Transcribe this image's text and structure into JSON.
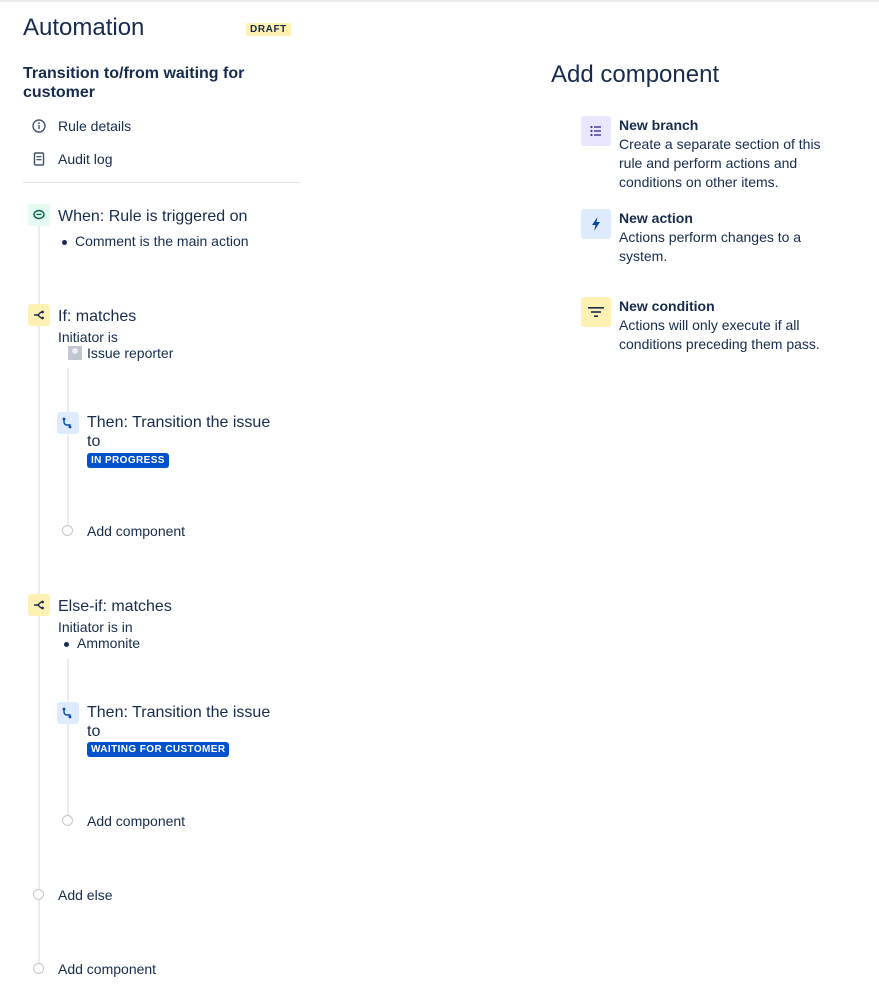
{
  "header": {
    "title": "Automation",
    "draft_badge": "DRAFT"
  },
  "rule": {
    "name": "Transition to/from waiting for customer"
  },
  "nav": {
    "rule_details": "Rule details",
    "audit_log": "Audit log"
  },
  "trigger": {
    "title": "When: Rule is triggered on",
    "bullet": "Comment is the main action"
  },
  "if_block": {
    "title": "If: matches",
    "sub": "Initiator is",
    "user": "Issue reporter",
    "action": {
      "title": "Then: Transition the issue to",
      "status": "IN PROGRESS"
    },
    "add_component": "Add component"
  },
  "elseif_block": {
    "title": "Else-if: matches",
    "sub": "Initiator is in",
    "bullet": "Ammonite",
    "action": {
      "title": "Then: Transition the issue to",
      "status": "WAITING FOR CUSTOMER"
    },
    "add_component": "Add component"
  },
  "add_else": "Add else",
  "add_component_root": "Add component",
  "panel": {
    "title": "Add component",
    "options": [
      {
        "title": "New branch",
        "desc": "Create a separate section of this rule and perform actions and conditions on other items.",
        "icon": "branch-icon"
      },
      {
        "title": "New action",
        "desc": "Actions perform changes to a system.",
        "icon": "lightning-icon"
      },
      {
        "title": "New condition",
        "desc": "Actions will only execute if all conditions preceding them pass.",
        "icon": "filter-icon"
      }
    ]
  },
  "colors": {
    "status_blue": "#0052CC",
    "draft_yellow": "#FFF0B3",
    "text": "#172B4D"
  }
}
